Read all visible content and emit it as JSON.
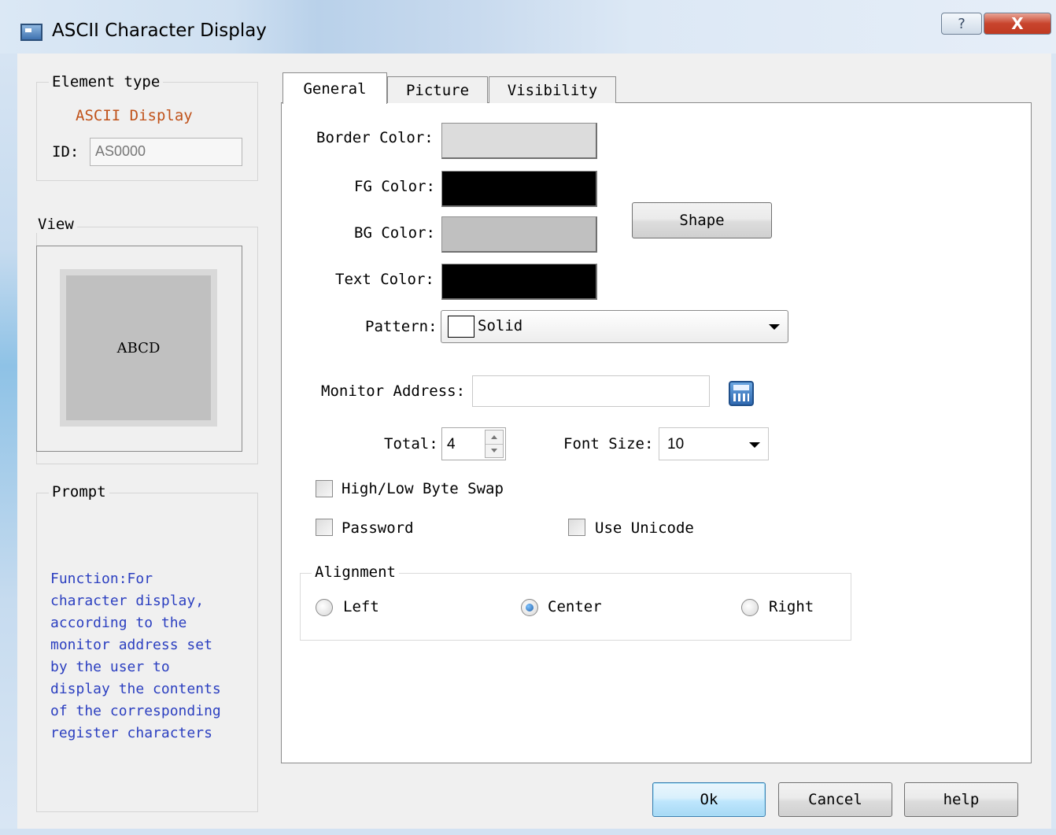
{
  "window": {
    "title": "ASCII Character Display",
    "help_glyph": "?",
    "close_glyph": "X"
  },
  "element_type": {
    "group_label": "Element type",
    "value": "ASCII Display",
    "id_label": "ID:",
    "id_value": "AS0000"
  },
  "view": {
    "group_label": "View",
    "preview_text": "ABCD"
  },
  "prompt": {
    "group_label": "Prompt",
    "text": "Function:For\ncharacter display,\naccording to the\nmonitor address set\nby the user to\ndisplay the contents\nof the corresponding\nregister characters"
  },
  "tabs": [
    {
      "label": "General",
      "active": true
    },
    {
      "label": "Picture",
      "active": false
    },
    {
      "label": "Visibility",
      "active": false
    }
  ],
  "general": {
    "border_color_label": "Border Color:",
    "fg_color_label": "FG Color:",
    "bg_color_label": "BG Color:",
    "text_color_label": "Text Color:",
    "shape_button": "Shape",
    "pattern_label": "Pattern:",
    "pattern_value": "Solid",
    "monitor_address_label": "Monitor Address:",
    "monitor_address_value": "",
    "total_label": "Total:",
    "total_value": "4",
    "font_size_label": "Font Size:",
    "font_size_value": "10",
    "high_low_swap_label": "High/Low Byte Swap",
    "high_low_swap_checked": false,
    "password_label": "Password",
    "password_checked": false,
    "use_unicode_label": "Use Unicode",
    "use_unicode_checked": false,
    "alignment_label": "Alignment",
    "alignment_options": [
      "Left",
      "Center",
      "Right"
    ],
    "alignment_selected": "Center"
  },
  "colors": {
    "border_color": "#dcdcdc",
    "fg_color": "#000000",
    "bg_color": "#c0c0c0",
    "text_color": "#000000",
    "element_type_value_color": "#c0521a",
    "prompt_text_color": "#2b3fc0"
  },
  "buttons": {
    "ok": "Ok",
    "cancel": "Cancel",
    "help": "help"
  },
  "icons": {
    "app": "window-icon",
    "calculator": "calculator-icon",
    "spin": "spin-up-down-icon",
    "dropdown": "chevron-down-icon"
  }
}
